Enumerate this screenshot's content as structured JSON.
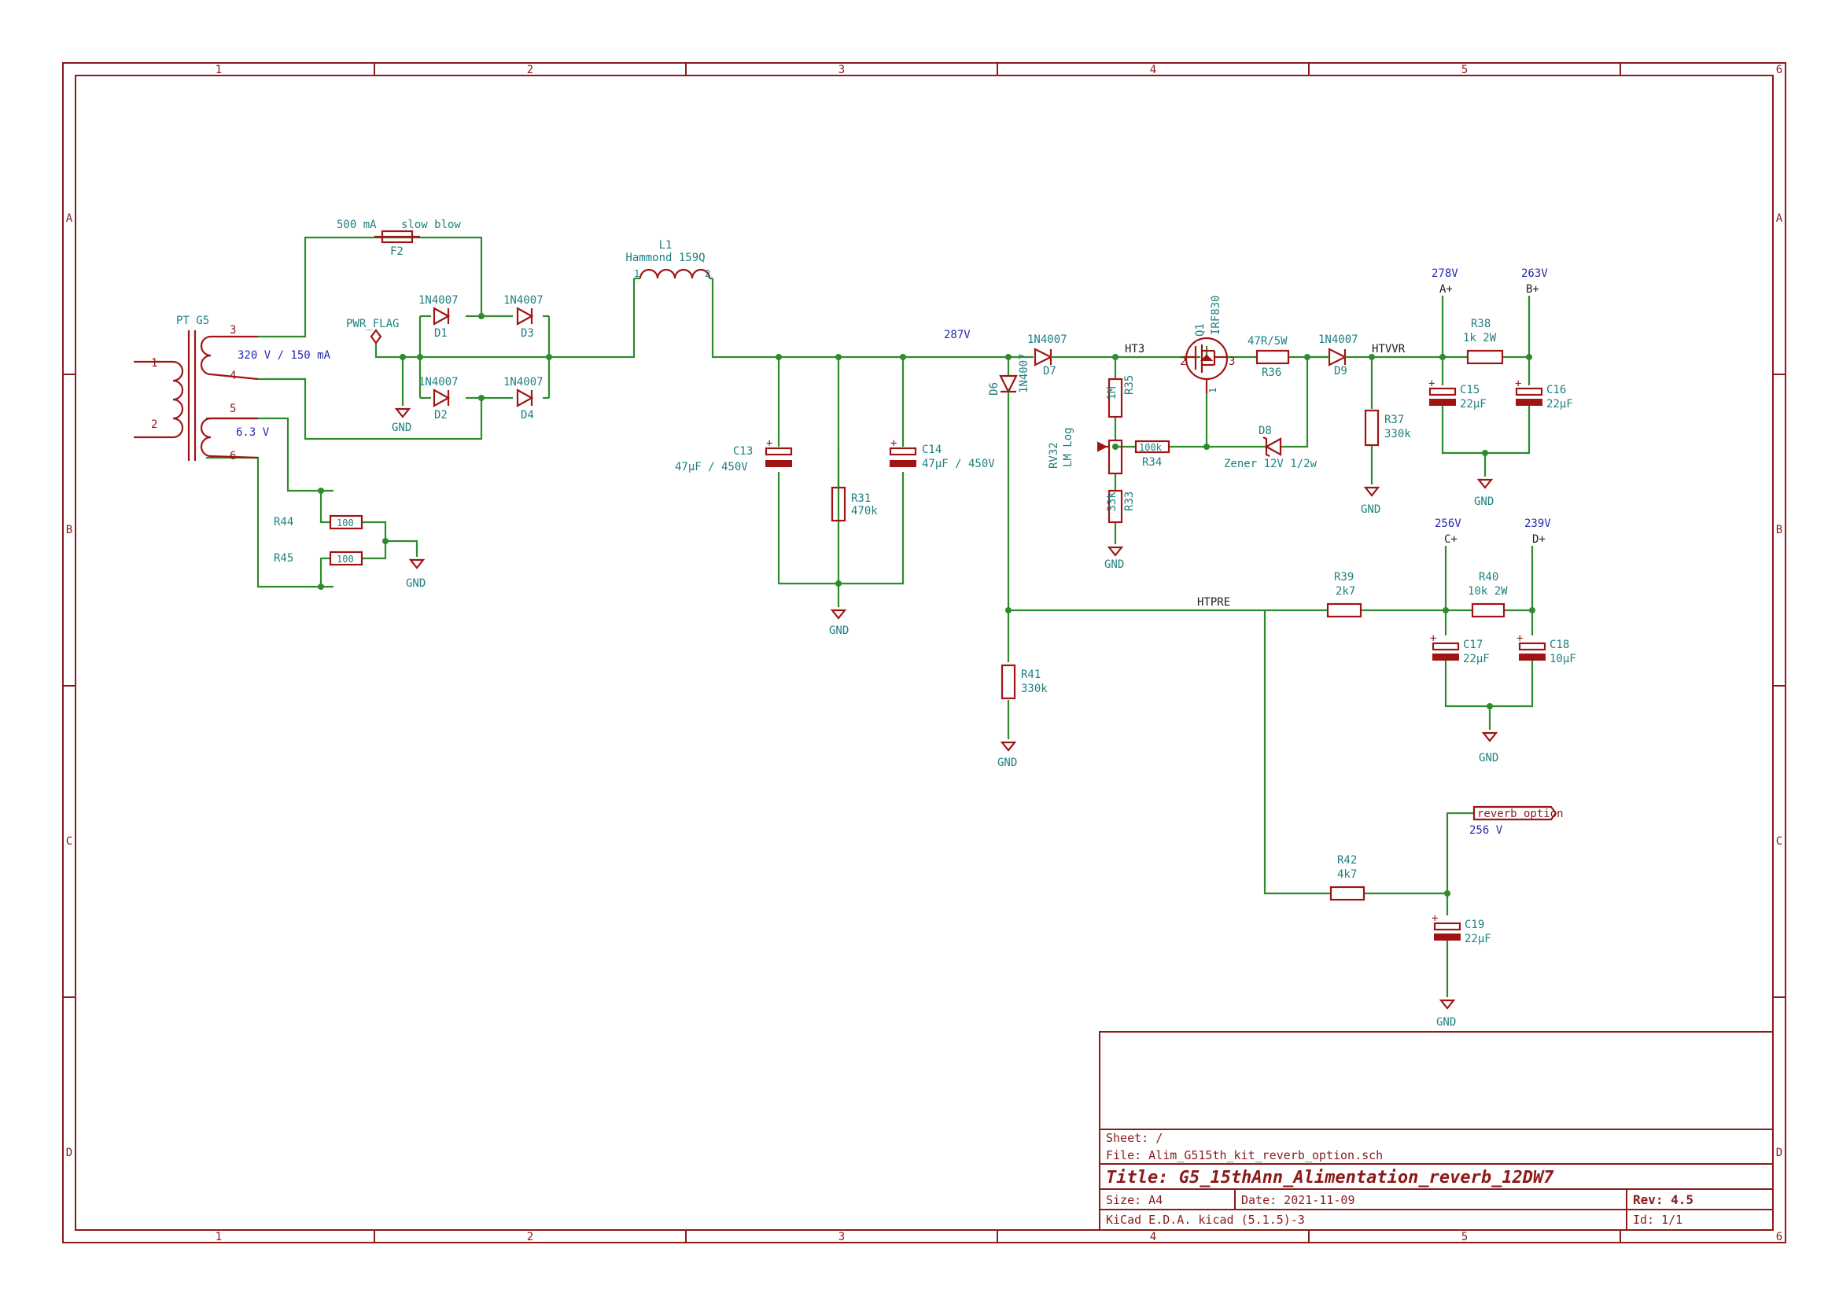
{
  "frame": {
    "columns": [
      "1",
      "2",
      "3",
      "4",
      "5",
      "6"
    ],
    "rows": [
      "A",
      "B",
      "C",
      "D"
    ]
  },
  "transformer": {
    "ref": "PT G5",
    "pins": [
      "1",
      "2",
      "3",
      "4",
      "5",
      "6"
    ],
    "hv_secondary": "320 V / 150 mA",
    "lv_secondary": "6.3 V"
  },
  "fuse": {
    "ref": "F2",
    "rating": "500 mA",
    "type": "slow blow"
  },
  "pwr_flag": "PWR_FLAG",
  "gnd": "GND",
  "diodes": {
    "D1": {
      "ref": "D1",
      "value": "1N4007"
    },
    "D2": {
      "ref": "D2",
      "value": "1N4007"
    },
    "D3": {
      "ref": "D3",
      "value": "1N4007"
    },
    "D4": {
      "ref": "D4",
      "value": "1N4007"
    },
    "D6": {
      "ref": "D6",
      "value": "1N4007"
    },
    "D7": {
      "ref": "D7",
      "value": "1N4007"
    },
    "D8": {
      "ref": "D8",
      "value": "Zener 12V 1/2w"
    },
    "D9": {
      "ref": "D9",
      "value": "1N4007"
    }
  },
  "inductor": {
    "ref": "L1",
    "value": "Hammond 159Q",
    "pin1": "1",
    "pin2": "2"
  },
  "capacitors": {
    "C13": {
      "ref": "C13",
      "value": "47µF / 450V"
    },
    "C14": {
      "ref": "C14",
      "value": "47µF / 450V"
    },
    "C15": {
      "ref": "C15",
      "value": "22µF"
    },
    "C16": {
      "ref": "C16",
      "value": "22µF"
    },
    "C17": {
      "ref": "C17",
      "value": "22µF"
    },
    "C18": {
      "ref": "C18",
      "value": "10µF"
    },
    "C19": {
      "ref": "C19",
      "value": "22µF"
    }
  },
  "resistors": {
    "R31": {
      "ref": "R31",
      "value": "470k"
    },
    "R33": {
      "ref": "R33",
      "value": "33k"
    },
    "R34": {
      "ref": "R34",
      "value": "100k"
    },
    "R35": {
      "ref": "R35",
      "value": "1M"
    },
    "R36": {
      "ref": "R36",
      "value": "47R/5W"
    },
    "R37": {
      "ref": "R37",
      "value": "330k"
    },
    "R38": {
      "ref": "R38",
      "value": "1k  2W"
    },
    "R39": {
      "ref": "R39",
      "value": "2k7"
    },
    "R40": {
      "ref": "R40",
      "value": "10k 2W"
    },
    "R41": {
      "ref": "R41",
      "value": "330k"
    },
    "R42": {
      "ref": "R42",
      "value": "4k7"
    },
    "R44": {
      "ref": "R44",
      "value": "100"
    },
    "R45": {
      "ref": "R45",
      "value": "100"
    }
  },
  "pot": {
    "ref": "RV32",
    "value": "LM Log"
  },
  "mosfet": {
    "ref": "Q1",
    "value": "IRF830",
    "pin1": "1",
    "pin2": "2",
    "pin3": "3"
  },
  "nets": {
    "ht3": "HT3",
    "htvvr": "HTVVR",
    "htpre": "HTPRE",
    "a": "A+",
    "b": "B+",
    "c": "C+",
    "d": "D+",
    "reverb": "reverb_option"
  },
  "voltages": {
    "v287": "287V",
    "v278": "278V",
    "v263": "263V",
    "v256": "256V",
    "v239": "239V",
    "v256r": "256 V"
  },
  "title_block": {
    "sheet": "Sheet: /",
    "file": "File: Alim_G515th_kit_reverb_option.sch",
    "title": "Title: G5_15thAnn_Alimentation_reverb_12DW7",
    "size": "Size: A4",
    "date": "Date: 2021-11-09",
    "rev": "Rev: 4.5",
    "tool": "KiCad E.D.A.  kicad (5.1.5)-3",
    "id": "Id: 1/1"
  }
}
